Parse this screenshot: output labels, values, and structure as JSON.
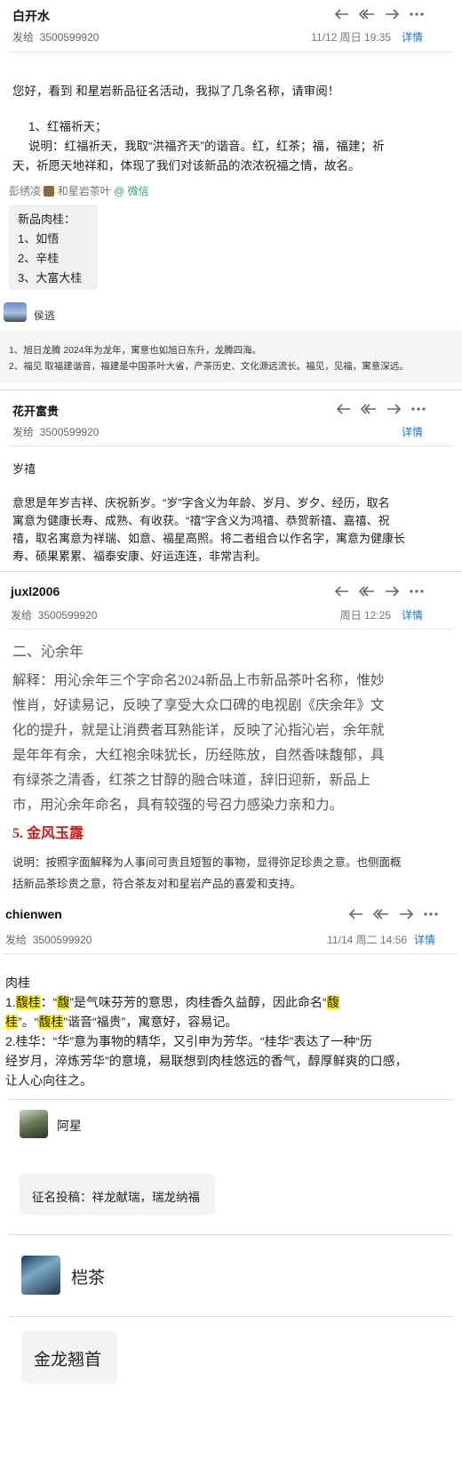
{
  "colors": {
    "link": "#1a73c9",
    "highlight": "#fff200",
    "red": "#d11a1a",
    "wechat": "#2aae67"
  },
  "email1": {
    "sender": "白开水",
    "to_label": "发给",
    "to": "3500599920",
    "time": "11/12 周日 19:35",
    "detail": "详情",
    "greeting": "您好，看到 和星岩新品征名活动，我拟了几条名称，请审阅！",
    "item": "1、红福祈天；",
    "explain1": "说明：红福祈天，我取“洪福齐天”的谐音。红，红茶；福，福建；祈",
    "explain2": "天，祈愿天地祥和，体现了我们对该新品的浓浓祝福之情，故名。"
  },
  "wechat": {
    "author": "彭绣凌",
    "channel": "和星岩茶叶",
    "via": "@ 微信",
    "lines": [
      "新品肉桂：",
      "1、如悟",
      "2、辛桂",
      "3、大富大桂"
    ]
  },
  "post1": {
    "author": "侯逃"
  },
  "note": {
    "line1": "1、旭日龙腾   2024年为龙年，寓意也如旭日东升，龙腾四海。",
    "line2": "2、福见  取福建谐音，福建是中国茶叶大省，产茶历史、文化源远流长。福见，见福，寓意深远。"
  },
  "email2": {
    "sender": "花开富贵",
    "to_label": "发给",
    "to": "3500599920",
    "detail": "详情",
    "title": "岁禧",
    "p1": "意思是年岁吉祥、庆祝新岁。“岁”字含义为年龄、岁月、岁夕、经历，取名",
    "p2": "寓意为健康长寿、成熟、有收获。“禧”字含义为鸿禧、恭贺新禧、嘉禧、祝",
    "p3": "禧，取名寓意为祥瑞、如意、福星高照。将二者组合以作名字，寓意为健康长",
    "p4": "寿、硕果累累、福泰安康、好运连连，非常吉利。"
  },
  "email3": {
    "sender": "juxl2006",
    "to_label": "发给",
    "to": "3500599920",
    "time": "周日 12:25",
    "detail": "详情",
    "heading": "二、沁余年",
    "l1": "解释：用沁余年三个字命名2024新品上市新品茶叶名称，惟妙",
    "l2": "惟肖，好读易记，反映了享受大众口碑的电视剧《庆余年》文",
    "l3": "化的提升，就是让消费者耳熟能详，反映了沁指沁岩，余年就",
    "l4": "是年年有余，大红袍余味犹长，历经陈放，自然香味馥郁，具",
    "l5": "有绿茶之清香，红茶之甘醇的融合味道，辞旧迎新，新品上",
    "l6": "市，用沁余年命名，具有较强的号召力感染力亲和力。",
    "red_title": "5. 金风玉露",
    "d1": "说明：按照字面解释为人事间可贵且短暂的事物，显得弥足珍贵之意。也侧面概",
    "d2": "括新品茶珍贵之意，符合茶友对和星岩产品的喜爱和支持。"
  },
  "email4": {
    "sender": "chienwen",
    "to_label": "发给",
    "to": "3500599920",
    "time": "11/14 周二 14:56",
    "detail": "详情",
    "t0": "肉桂",
    "t1a": "1.",
    "t1b": "馥桂",
    "t1c": "：“",
    "t1d": "馥",
    "t1e": "”是气味芬芳的意思，肉桂香久益醇，因此命名“",
    "t1f": "馥",
    "t2a": "桂",
    "t2b": "”。“",
    "t2c": "馥桂",
    "t2d": "”谐音“福贵”，寓意好，容易记。",
    "t3": "2.桂华：“华”意为事物的精华，又引申为芳华。“桂华”表达了一种“历",
    "t4": "经岁月，淬炼芳华”的意境，易联想到肉桂悠远的香气，醇厚鲜爽的口感，",
    "t5": "让人心向往之。"
  },
  "post2": {
    "author": "阿星",
    "text": "征名投稿：祥龙献瑞，瑞龙纳福"
  },
  "post3": {
    "author": "桤茶",
    "text": "金龙翘首"
  }
}
